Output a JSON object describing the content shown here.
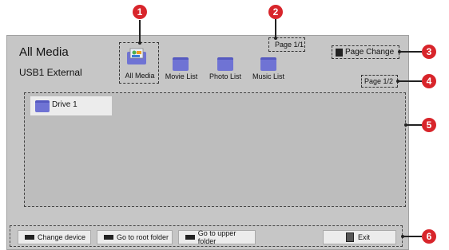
{
  "header": {
    "title": "All Media",
    "subtitle": "USB1 External"
  },
  "categories": [
    {
      "label": "All Media",
      "icon": "all-media-icon"
    },
    {
      "label": "Movie List",
      "icon": "folder-icon"
    },
    {
      "label": "Photo List",
      "icon": "folder-icon"
    },
    {
      "label": "Music List",
      "icon": "folder-icon"
    }
  ],
  "page_top": "Page 1/1",
  "page_change": "Page Change",
  "page_bottom": "Page 1/2",
  "list": {
    "drive_label": "Drive 1"
  },
  "footer": {
    "change_device": "Change device",
    "root_folder": "Go to root folder",
    "upper_folder": "Go to upper folder",
    "exit": "Exit"
  },
  "callouts": [
    "1",
    "2",
    "3",
    "4",
    "5",
    "6"
  ],
  "colors": {
    "callout": "#d8252b",
    "folder": "#6f73d4",
    "screen": "#c6c6c6"
  }
}
